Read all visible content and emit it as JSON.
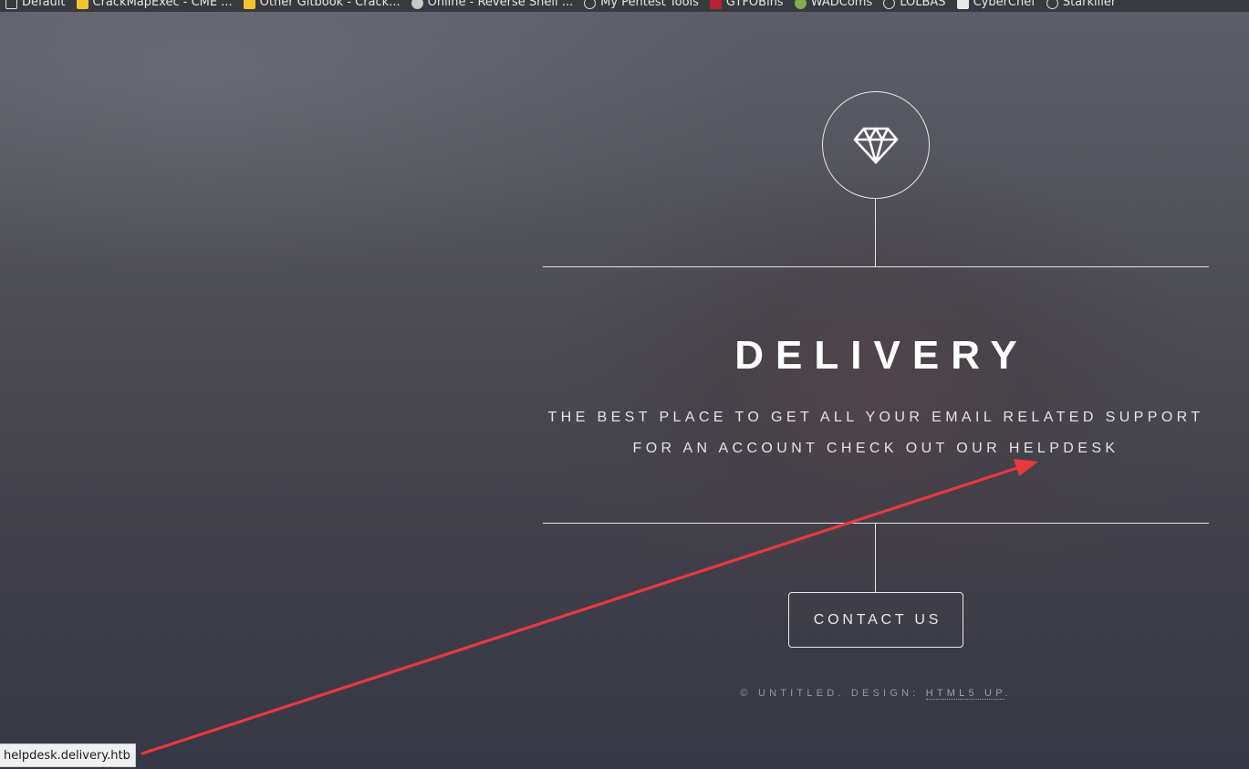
{
  "bookmarks": [
    {
      "label": "Default",
      "icon": "folder-icon"
    },
    {
      "label": "CrackMapExec - CME ...",
      "icon": "gitbook-icon"
    },
    {
      "label": "Other Gitbook - Crack...",
      "icon": "gitbook-icon"
    },
    {
      "label": "Online - Reverse Shell ...",
      "icon": "gear-icon"
    },
    {
      "label": "My Pentest Tools",
      "icon": "globe-icon"
    },
    {
      "label": "GTFOBins",
      "icon": "gtfobins-icon"
    },
    {
      "label": "WADComs",
      "icon": "wadcoms-icon"
    },
    {
      "label": "LOLBAS",
      "icon": "globe-icon"
    },
    {
      "label": "CyberChef",
      "icon": "cyberchef-icon"
    },
    {
      "label": "Starkiller",
      "icon": "globe-icon"
    }
  ],
  "main": {
    "logo_icon": "diamond-icon",
    "title": "DELIVERY",
    "tagline_line1": "THE BEST PLACE TO GET ALL YOUR EMAIL RELATED SUPPORT",
    "tagline_line2_prefix": "FOR AN ACCOUNT CHECK OUT OUR ",
    "helpdesk_link": "HELPDESK",
    "contact_button": "CONTACT US"
  },
  "footer": {
    "copyright": "© UNTITLED. DESIGN: ",
    "credit_link": "HTML5 UP",
    "trailing": "."
  },
  "status_bar": {
    "link_preview": "helpdesk.delivery.htb"
  },
  "colors": {
    "annotation_arrow": "#e8393f",
    "text_primary": "#ffffff",
    "lines": "#e4e4e4"
  }
}
